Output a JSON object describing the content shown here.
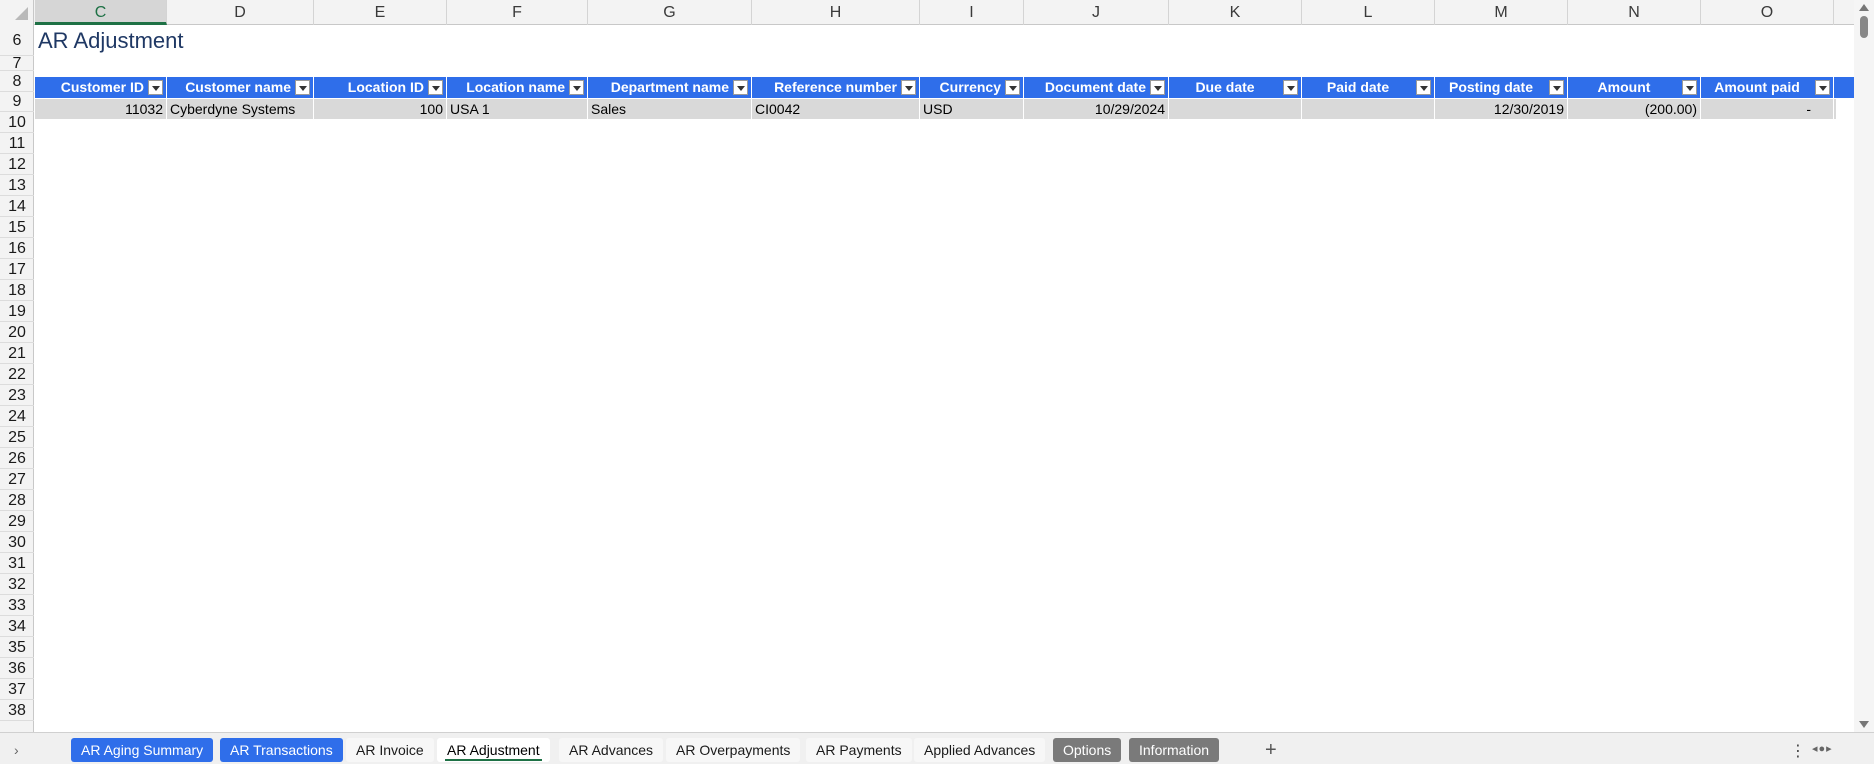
{
  "sheet": {
    "title": "AR Adjustment",
    "active_column": "C",
    "columns": [
      "C",
      "D",
      "E",
      "F",
      "G",
      "H",
      "I",
      "J",
      "K",
      "L",
      "M",
      "N",
      "O"
    ],
    "rows": [
      "6",
      "7",
      "8",
      "9",
      "10",
      "11",
      "12",
      "13",
      "14",
      "15",
      "16",
      "17",
      "18",
      "19",
      "20",
      "21",
      "22",
      "23",
      "24",
      "25",
      "26",
      "27",
      "28",
      "29",
      "30",
      "31",
      "32",
      "33",
      "34",
      "35",
      "36",
      "37",
      "38"
    ]
  },
  "table": {
    "headers": [
      "Customer ID",
      "Customer name",
      "Location ID",
      "Location name",
      "Department name",
      "Reference number",
      "Currency",
      "Document date",
      "Due date",
      "Paid date",
      "Posting date",
      "Amount",
      "Amount paid"
    ],
    "row": [
      "11032",
      "Cyberdyne Systems",
      "100",
      "USA 1",
      "Sales",
      "CI0042",
      "USD",
      "10/29/2024",
      "",
      "",
      "12/30/2019",
      "(200.00)",
      "-"
    ]
  },
  "tabs": [
    {
      "label": "AR Aging Summary",
      "style": "blue"
    },
    {
      "label": "AR Transactions",
      "style": "blue"
    },
    {
      "label": "AR Invoice",
      "style": "plain"
    },
    {
      "label": "AR Adjustment",
      "style": "active"
    },
    {
      "label": "AR Advances",
      "style": "plain"
    },
    {
      "label": "AR Overpayments",
      "style": "plain"
    },
    {
      "label": "AR Payments",
      "style": "plain"
    },
    {
      "label": "Applied Advances",
      "style": "plain"
    },
    {
      "label": "Options",
      "style": "gray"
    },
    {
      "label": "Information",
      "style": "gray"
    }
  ],
  "icons": {
    "tab_nav": "chevron-right-icon",
    "add_sheet": "plus-icon",
    "more": "more-vertical-icon"
  },
  "colors": {
    "header_blue": "#2f6eea",
    "active_green": "#1e7145",
    "row_fill": "#d9d9d9",
    "title_color": "#1f3864"
  }
}
